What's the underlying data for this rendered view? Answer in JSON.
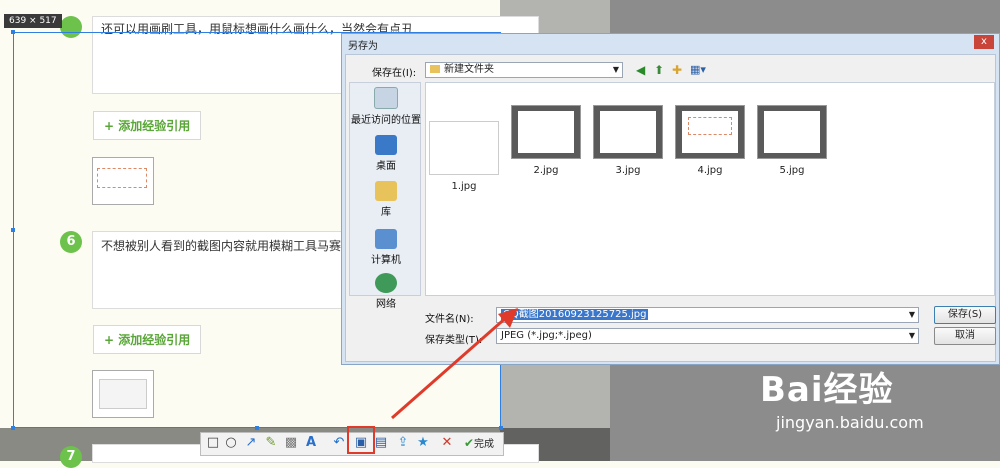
{
  "capture": {
    "size_label": "639 × 517"
  },
  "steps": [
    {
      "number": "",
      "text": "还可以用画刷工具，用鼠标想画什么画什么，当然会有点丑"
    },
    {
      "number": "6",
      "text": "不想被别人看到的截图内容就用模糊工具马赛"
    },
    {
      "number": "7",
      "text": ""
    }
  ],
  "add_reference_label": "+ 添加经验引用",
  "dialog": {
    "title": "另存为",
    "close_label": "x",
    "save_in_label": "保存在(I):",
    "save_in_value": "新建文件夹",
    "places": [
      {
        "label": "最近访问的位置",
        "icon": "recent-places-icon"
      },
      {
        "label": "桌面",
        "icon": "desktop-icon"
      },
      {
        "label": "库",
        "icon": "library-icon"
      },
      {
        "label": "计算机",
        "icon": "computer-icon"
      },
      {
        "label": "网络",
        "icon": "network-icon"
      }
    ],
    "files": [
      "1.jpg",
      "2.jpg",
      "3.jpg",
      "4.jpg",
      "5.jpg"
    ],
    "filename_label": "文件名(N):",
    "filename_value": "QQ截图20160923125725.jpg",
    "filetype_label": "保存类型(T):",
    "filetype_value": "JPEG (*.jpg;*.jpeg)",
    "save_button": "保存(S)",
    "cancel_button": "取消"
  },
  "toolbar": {
    "tools": [
      "rectangle-icon",
      "ellipse-icon",
      "arrow-icon",
      "brush-icon",
      "mosaic-icon",
      "text-icon",
      "undo-icon",
      "save-icon",
      "copy-icon",
      "share-icon",
      "pin-icon",
      "cancel-icon"
    ],
    "done_label": "完成"
  },
  "watermark": {
    "brand": "Bai经验",
    "url": "jingyan.baidu.com"
  },
  "colors": {
    "accent_green": "#6cc24a",
    "selection_blue": "#2f7fe0",
    "highlight_red": "#e03b2a"
  }
}
